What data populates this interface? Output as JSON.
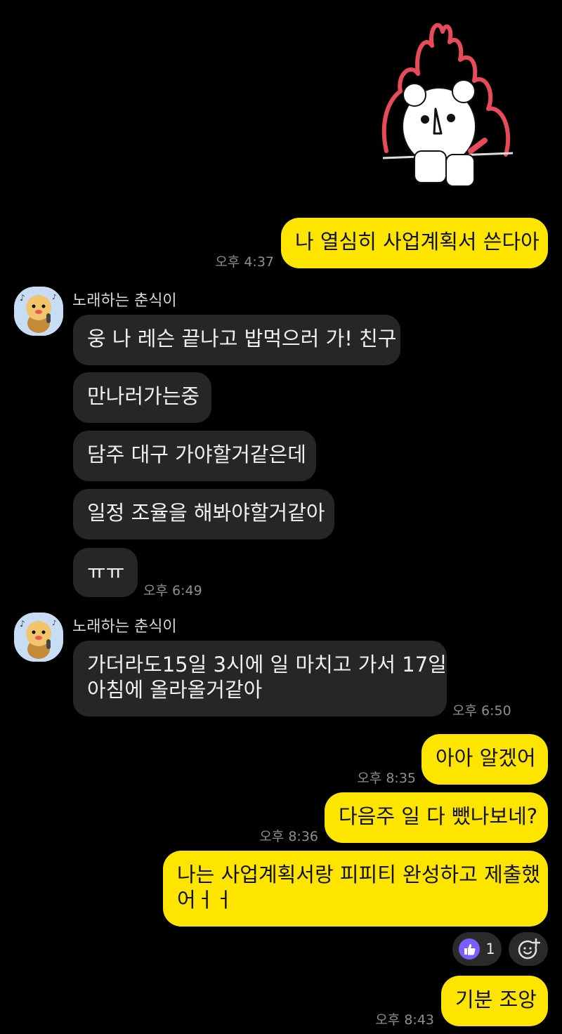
{
  "sticker": {
    "icon": "angry-bear-fire-sticker"
  },
  "colors": {
    "my_bubble": "#fee500",
    "their_bubble": "#262626",
    "background": "#000000",
    "reaction_badge": "#7b5cff"
  },
  "messages": [
    {
      "text": "나 열심히 사업계획서 쓴다아",
      "time": "오후 4:37"
    },
    {
      "sender": "노래하는 춘식이"
    },
    {
      "text": "웅 나 레슨 끝나고 밥먹으러 가! 친구"
    },
    {
      "text": "만나러가는중"
    },
    {
      "text": "담주 대구 가야할거같은데"
    },
    {
      "text": "일정 조율을 해봐야할거같아"
    },
    {
      "text": "ㅠㅠ",
      "time": "오후 6:49"
    },
    {
      "sender": "노래하는 춘식이"
    },
    {
      "text_line1": "가더라도15일 3시에 일 마치고 가서 17일",
      "text_line2": "아침에 올라올거같아",
      "time": "오후 6:50"
    },
    {
      "text": "아아 알겠어",
      "time": "오후 8:35"
    },
    {
      "text": "다음주 일 다 뺐나보네?",
      "time": "오후 8:36"
    },
    {
      "text_line1": "나는 사업계획서랑 피피티 완성하고 제출했",
      "text_line2": "어ㅓㅓ"
    },
    {
      "reaction_count": "1",
      "reaction_icon": "thumbs-up-icon",
      "add_icon": "add-reaction-icon"
    },
    {
      "text": "기분 조앙",
      "time": "오후 8:43"
    }
  ]
}
